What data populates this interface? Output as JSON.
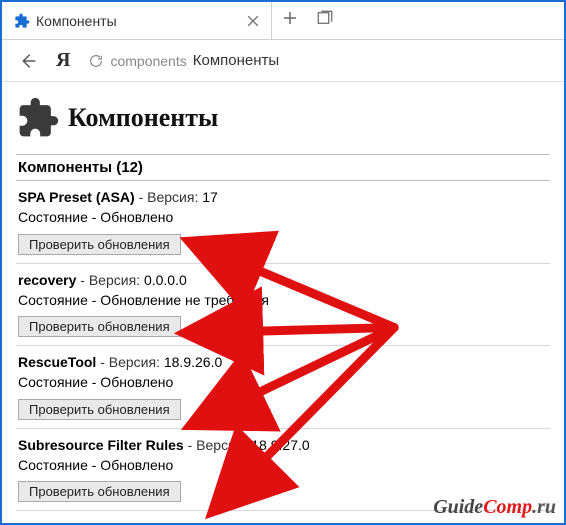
{
  "tab": {
    "title": "Компоненты"
  },
  "address": {
    "host": "components",
    "caption": "Компоненты"
  },
  "page": {
    "heading": "Компоненты",
    "section_header": "Компоненты (12)",
    "version_label": "Версия",
    "status_label": "Состояние",
    "check_button": "Проверить обновления"
  },
  "components": [
    {
      "name": "SPA Preset (ASA)",
      "version": "17",
      "status": "Обновлено"
    },
    {
      "name": "recovery",
      "version": "0.0.0.0",
      "status": "Обновление не требуется"
    },
    {
      "name": "RescueTool",
      "version": "18.9.26.0",
      "status": "Обновлено"
    },
    {
      "name": "Subresource Filter Rules",
      "version": "18.9.27.0",
      "status": "Обновлено"
    }
  ],
  "watermark": {
    "text1": "Guide",
    "text2": "Comp",
    "tld": ".ru"
  }
}
